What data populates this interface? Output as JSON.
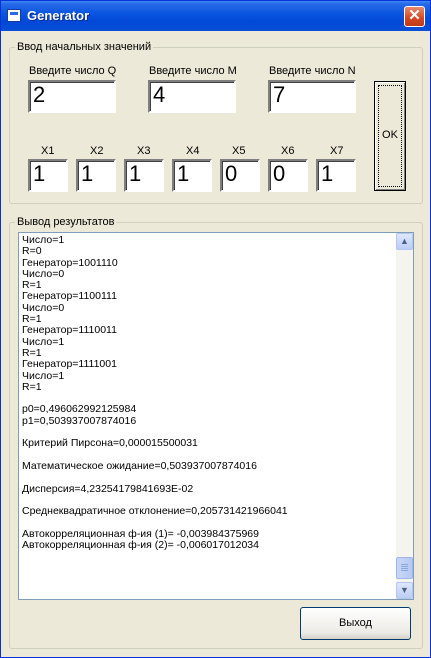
{
  "window": {
    "title": "Generator",
    "close_glyph": "✕"
  },
  "input_group": {
    "legend": "Ввод начальных значений",
    "q": {
      "label": "Введите число Q",
      "value": "2"
    },
    "m": {
      "label": "Введите число M",
      "value": "4"
    },
    "n": {
      "label": "Введите число N",
      "value": "7"
    },
    "x": [
      {
        "label": "X1",
        "value": "1"
      },
      {
        "label": "X2",
        "value": "1"
      },
      {
        "label": "X3",
        "value": "1"
      },
      {
        "label": "X4",
        "value": "1"
      },
      {
        "label": "X5",
        "value": "0"
      },
      {
        "label": "X6",
        "value": "0"
      },
      {
        "label": "X7",
        "value": "1"
      }
    ],
    "ok_label": "OK"
  },
  "output_group": {
    "legend": "Вывод результатов",
    "lines": [
      "Число=1",
      "R=0",
      "Генератор=1001110",
      "Число=0",
      "R=1",
      "Генератор=1100111",
      "Число=0",
      "R=1",
      "Генератор=1110011",
      "Число=1",
      "R=1",
      "Генератор=1111001",
      "Число=1",
      "R=1",
      "",
      "p0=0,496062992125984",
      "p1=0,503937007874016",
      "",
      "Критерий Пирсона=0,000015500031",
      "",
      "Математическое ожидание=0,503937007874016",
      "",
      "Дисперсия=4,23254179841693E-02",
      "",
      "Среднеквадратичное отклонение=0,205731421966041",
      "",
      "Автокорреляционная ф-ия (1)= -0,003984375969",
      "Автокорреляционная ф-ия (2)= -0,006017012034"
    ],
    "scroll_up": "▲",
    "scroll_down": "▼"
  },
  "exit_label": "Выход"
}
